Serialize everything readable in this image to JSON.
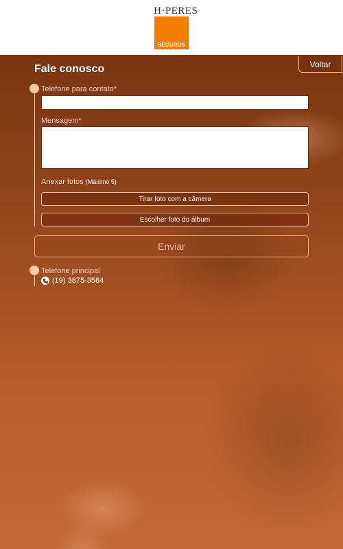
{
  "header": {
    "logo_word": "H·PERES",
    "logo_sub": "SEGUROS"
  },
  "nav": {
    "back_label": "Voltar"
  },
  "page": {
    "title": "Fale conosco"
  },
  "form": {
    "phone_label": "Telefone para contato*",
    "phone_value": "",
    "message_label": "Mensagem*",
    "message_value": "",
    "attach_label": "Anexar fotos",
    "attach_hint": "(Máximo 5)",
    "camera_button": "Tirar foto com a câmera",
    "album_button": "Escolher foto do álbum",
    "send_button": "Enviar"
  },
  "contact": {
    "main_phone_label": "Telefone principal",
    "main_phone_value": "(19) 3875-3584"
  },
  "colors": {
    "brand_orange": "#f07d00",
    "background": "#a4501a",
    "accent_peach": "#f6c9a3"
  }
}
